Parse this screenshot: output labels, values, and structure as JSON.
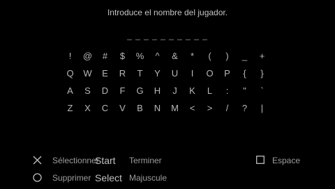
{
  "prompt": "Introduce el nombre del jugador.",
  "entry_display": "_  _ _   _ _ _ _ _ _ _",
  "keyboard": {
    "rows": [
      [
        "!",
        "@",
        "#",
        "$",
        "%",
        "^",
        "&",
        "*",
        "(",
        ")",
        "_",
        "+"
      ],
      [
        "Q",
        "W",
        "E",
        "R",
        "T",
        "Y",
        "U",
        "I",
        "O",
        "P",
        "{",
        "}"
      ],
      [
        "A",
        "S",
        "D",
        "F",
        "G",
        "H",
        "J",
        "K",
        "L",
        ":",
        "\"",
        "`"
      ],
      [
        "Z",
        "X",
        "C",
        "V",
        "B",
        "N",
        "M",
        "<",
        ">",
        "/",
        "?",
        "|"
      ]
    ]
  },
  "controls": {
    "cross_label": "Sélectionner",
    "start_button": "Start",
    "start_label": "Terminer",
    "circle_label": "Supprimer",
    "select_button": "Select",
    "select_label": "Majuscule",
    "square_label": "Espace"
  },
  "icons": [
    "cross-icon",
    "circle-icon",
    "square-icon"
  ]
}
